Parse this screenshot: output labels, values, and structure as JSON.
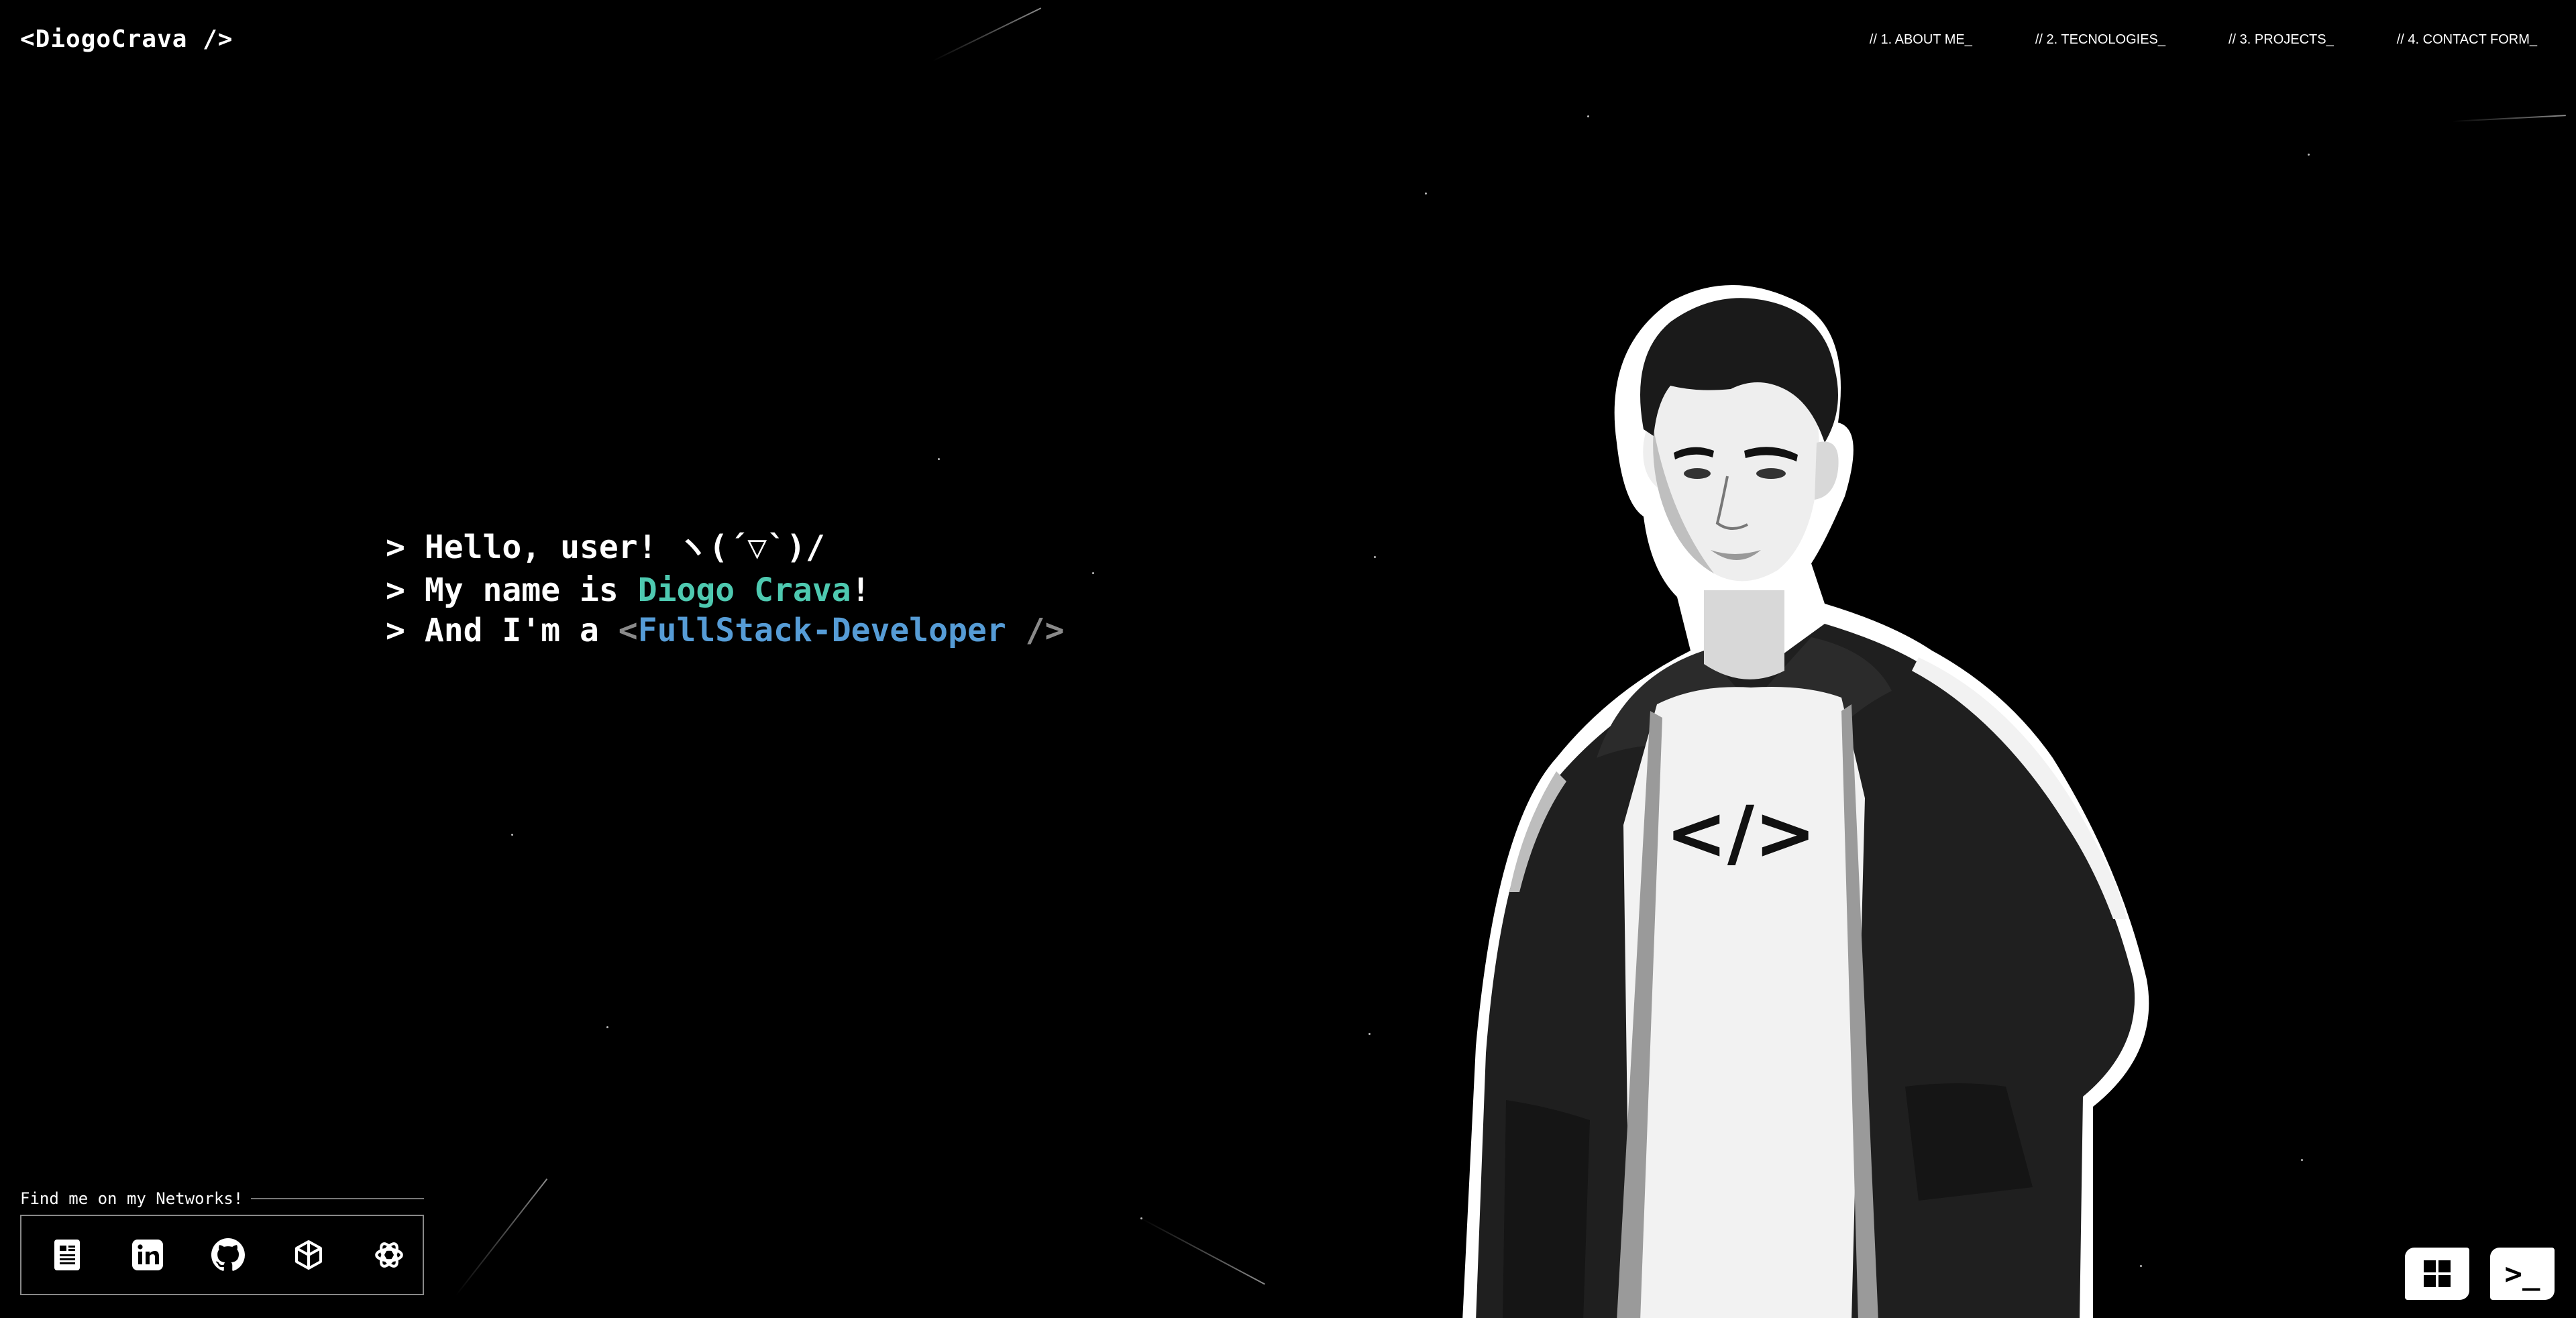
{
  "header": {
    "logo": "<DiogoCrava />",
    "nav": [
      {
        "label": "// 1. ABOUT ME_"
      },
      {
        "label": "// 2. TECNOLOGIES_"
      },
      {
        "label": "// 3. PROJECTS_"
      },
      {
        "label": "// 4. CONTACT FORM_"
      }
    ]
  },
  "intro": {
    "prompt": ">",
    "line1": "Hello, user! ヽ(´▽`)/",
    "line2_prefix": "My name is ",
    "line2_name": "Diogo Crava",
    "line2_suffix": "!",
    "line3_prefix": "And I'm a ",
    "line3_open": "<",
    "line3_role": "FullStack-Developer",
    "line3_close": " />"
  },
  "networks": {
    "title": "Find me on my Networks!",
    "icons": [
      "resume-icon",
      "linkedin-icon",
      "github-icon",
      "cube-icon",
      "openai-icon"
    ]
  },
  "portrait": {
    "shirt_text": "</>"
  },
  "floating_buttons": {
    "grid_icon": "grid-icon",
    "terminal_label": ">_"
  },
  "colors": {
    "background": "#000000",
    "text": "#ffffff",
    "name_accent": "#4ec9b0",
    "role_accent": "#569cd6",
    "tag_gray": "#8a8a8a"
  }
}
